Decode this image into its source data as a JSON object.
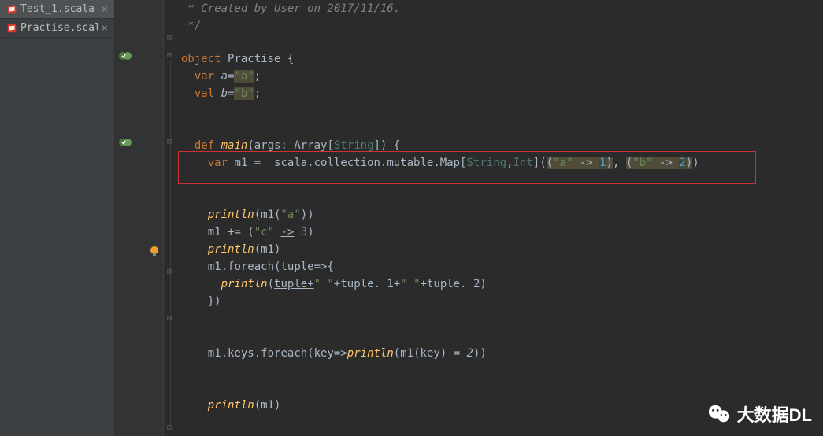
{
  "tabs": [
    {
      "name": "Test_1.scala",
      "active": true
    },
    {
      "name": "Practise.scala",
      "active": false
    }
  ],
  "code": {
    "comment1": " * Created by User on 2017/11/16.",
    "comment2": " */",
    "kw_object": "object",
    "class_name": "Practise",
    "kw_var": "var",
    "kw_val": "val",
    "var_a": "a",
    "var_b": "b",
    "eq": "=",
    "str_a": "\"a\"",
    "str_b": "\"b\"",
    "str_c": "\"c\"",
    "kw_def": "def",
    "fn_main": "main",
    "args": "args",
    "colon": ":",
    "Array": "Array",
    "String": "String",
    "Int": "Int",
    "m1": "m1",
    "scala_path": "scala.collection.mutable.Map",
    "arrow": "->",
    "n1": "1",
    "n2": "2",
    "n3": "3",
    "println": "println",
    "plus_eq": "+=",
    "foreach": "foreach",
    "tuple": "tuple",
    "fat_arrow": "=>",
    "tuple1": "tuple._1",
    "tuple2": "tuple._2",
    "sp": "\" \"",
    "keys": "keys",
    "key": "key",
    "eq2": "= 2"
  },
  "watermark": {
    "text": "大数据DL"
  }
}
